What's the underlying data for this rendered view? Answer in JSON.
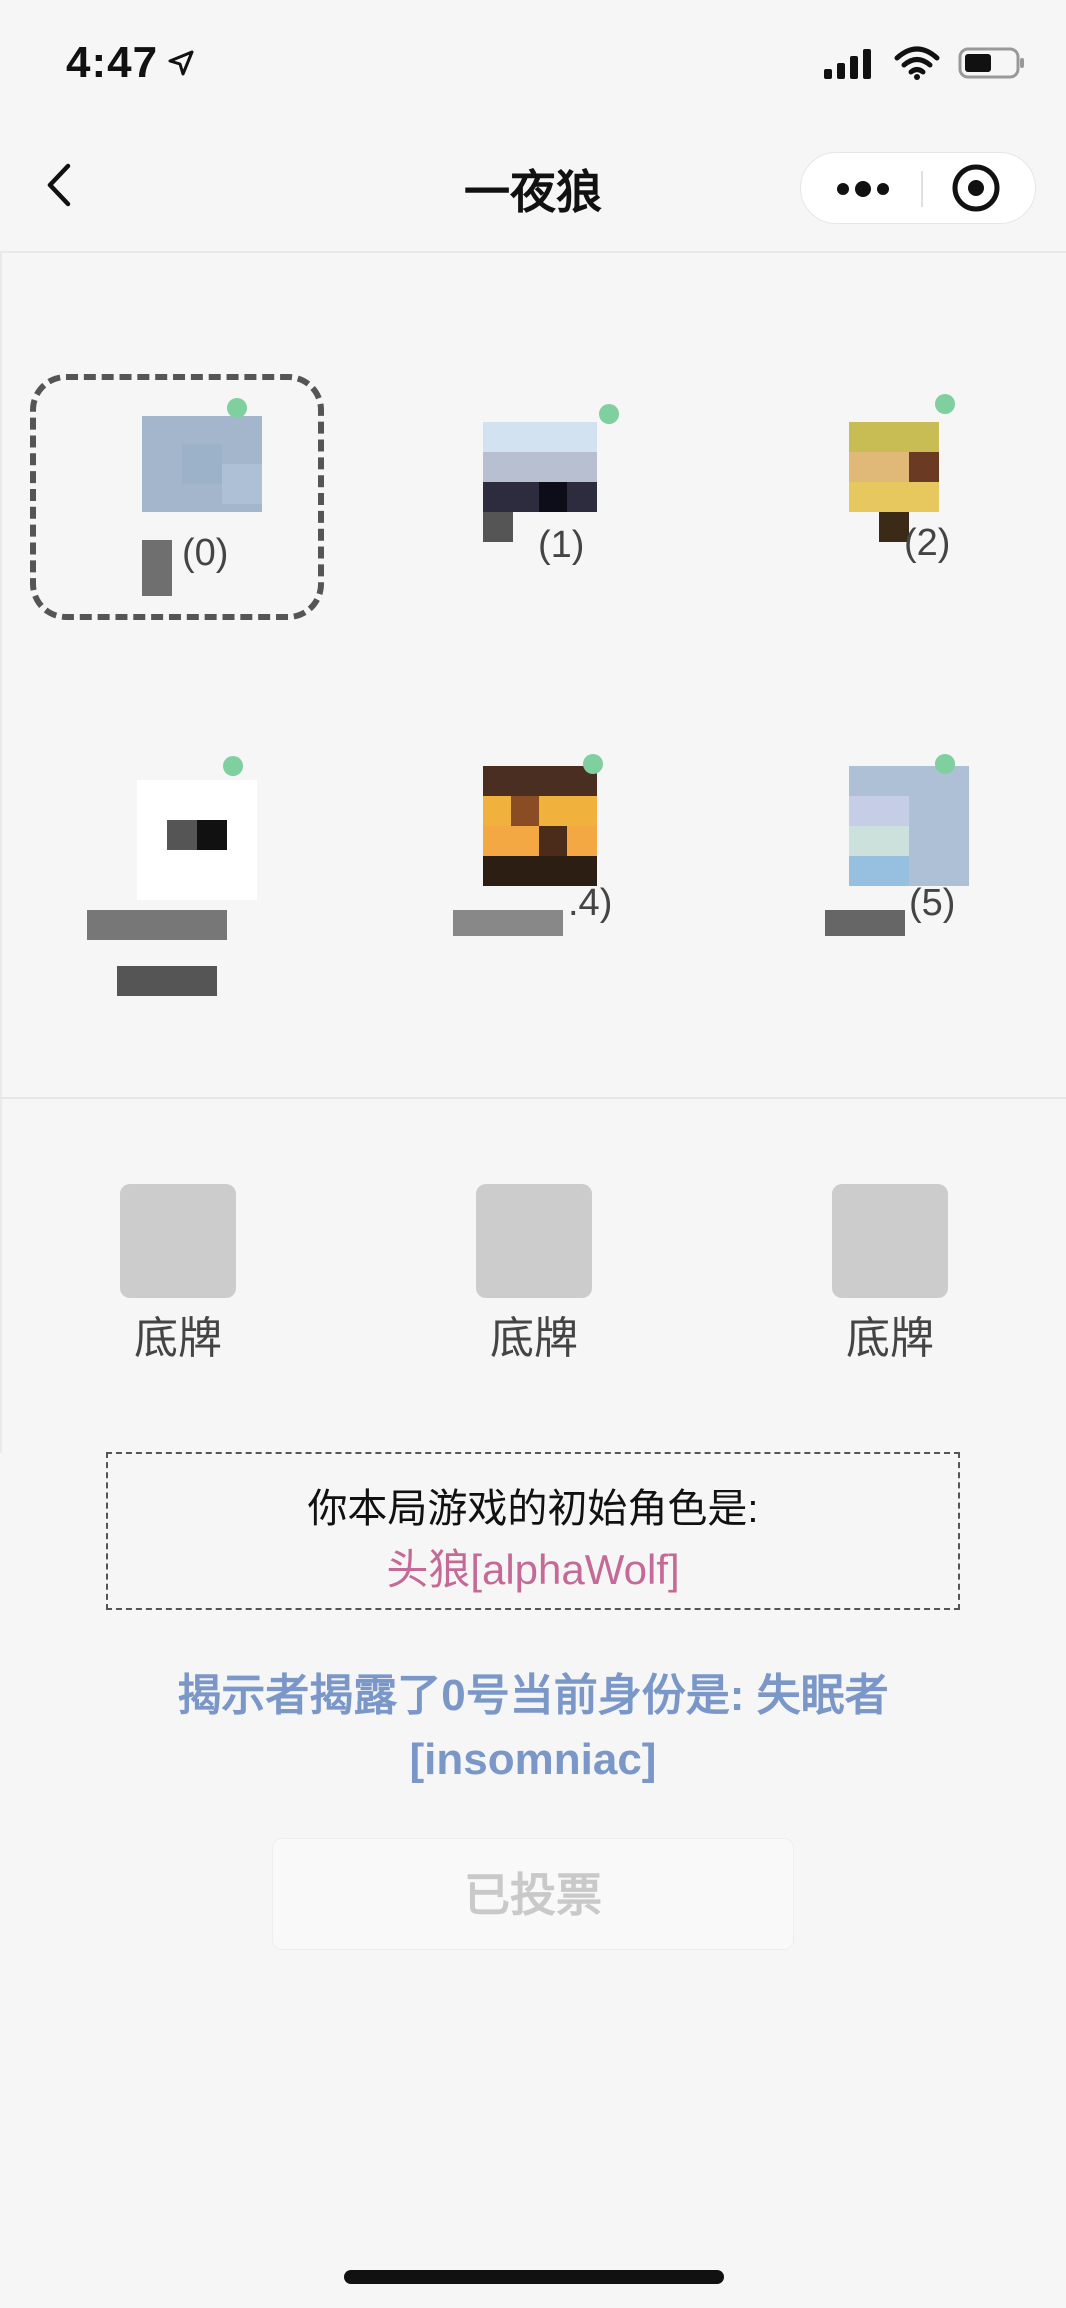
{
  "status_bar": {
    "time": "4:47",
    "icons": [
      "location-arrow-icon",
      "cellular-signal-icon",
      "wifi-icon",
      "battery-icon"
    ]
  },
  "nav": {
    "title": "一夜狼",
    "back_icon": "chevron-left-icon",
    "capsule_icons": [
      "more-dots-icon",
      "target-icon"
    ]
  },
  "players": [
    {
      "label": "(0)",
      "selected": true
    },
    {
      "label": "(1)"
    },
    {
      "label": "(2)"
    },
    {
      "label": ""
    },
    {
      "label": ".4)"
    },
    {
      "label": "(5)"
    }
  ],
  "center_cards": [
    {
      "label": "底牌"
    },
    {
      "label": "底牌"
    },
    {
      "label": "底牌"
    }
  ],
  "role": {
    "prompt": "你本局游戏的初始角色是:",
    "value": "头狼[alphaWolf]"
  },
  "reveal": {
    "line1": "揭示者揭露了0号当前身份是: 失眠者",
    "line2": "[insomniac]"
  },
  "actions": {
    "voted_label": "已投票"
  },
  "colors": {
    "role_value": "#c56a97",
    "reveal_text": "#7a97c8",
    "online_dot": "#7fcf9f"
  }
}
